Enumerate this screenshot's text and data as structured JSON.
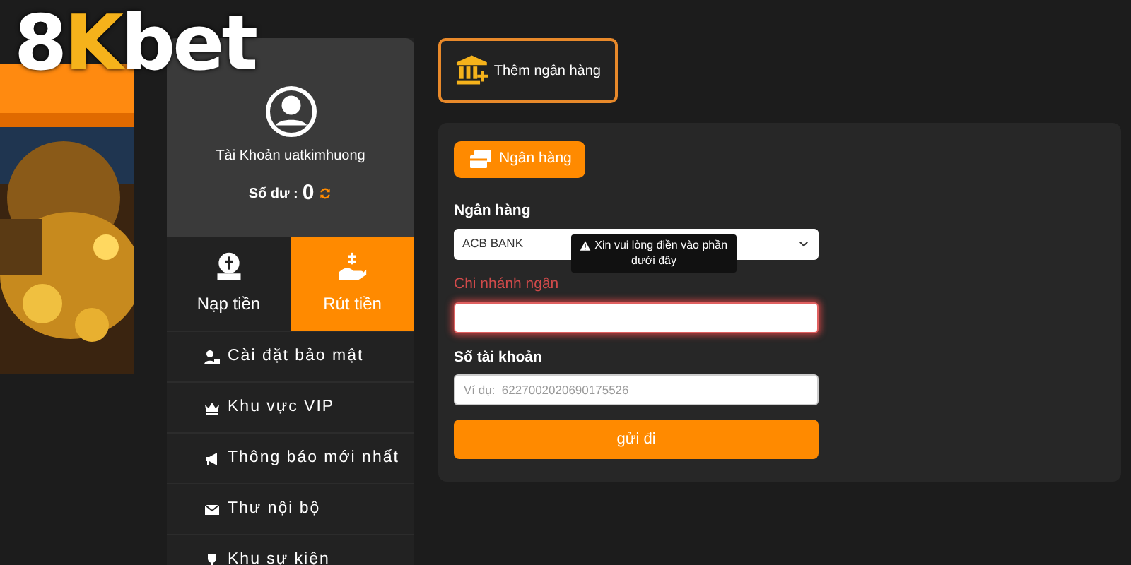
{
  "logo": {
    "parts": [
      "8",
      "K",
      "bet"
    ]
  },
  "profile": {
    "account": "Tài Khoản uatkimhuong",
    "balance_label": "Số dư :",
    "balance": "0"
  },
  "tabs": [
    {
      "label": "Nạp tiền",
      "selected": false
    },
    {
      "label": "Rút tiền",
      "selected": true
    }
  ],
  "menu": [
    {
      "label": "Cài đặt bảo mật"
    },
    {
      "label": "Khu vực VIP"
    },
    {
      "label": "Thông báo mới nhất"
    },
    {
      "label": "Thư nội bộ"
    },
    {
      "label": "Khu sự kiện"
    }
  ],
  "add_bank_button": "Thêm ngân hàng",
  "method_tabs": [
    {
      "label": "Ngân hàng",
      "selected": true
    }
  ],
  "form": {
    "bank_label": "Ngân hàng",
    "bank_value": "ACB BANK",
    "branch_label": "Chi nhánh ngân",
    "branch_invalid": true,
    "tooltip": "Xin vui lòng điền vào phần dưới đây",
    "account_label": "Số tài khoản",
    "account_placeholder": "Ví dụ:  6227002020690175526",
    "submit": "gửi đi"
  }
}
